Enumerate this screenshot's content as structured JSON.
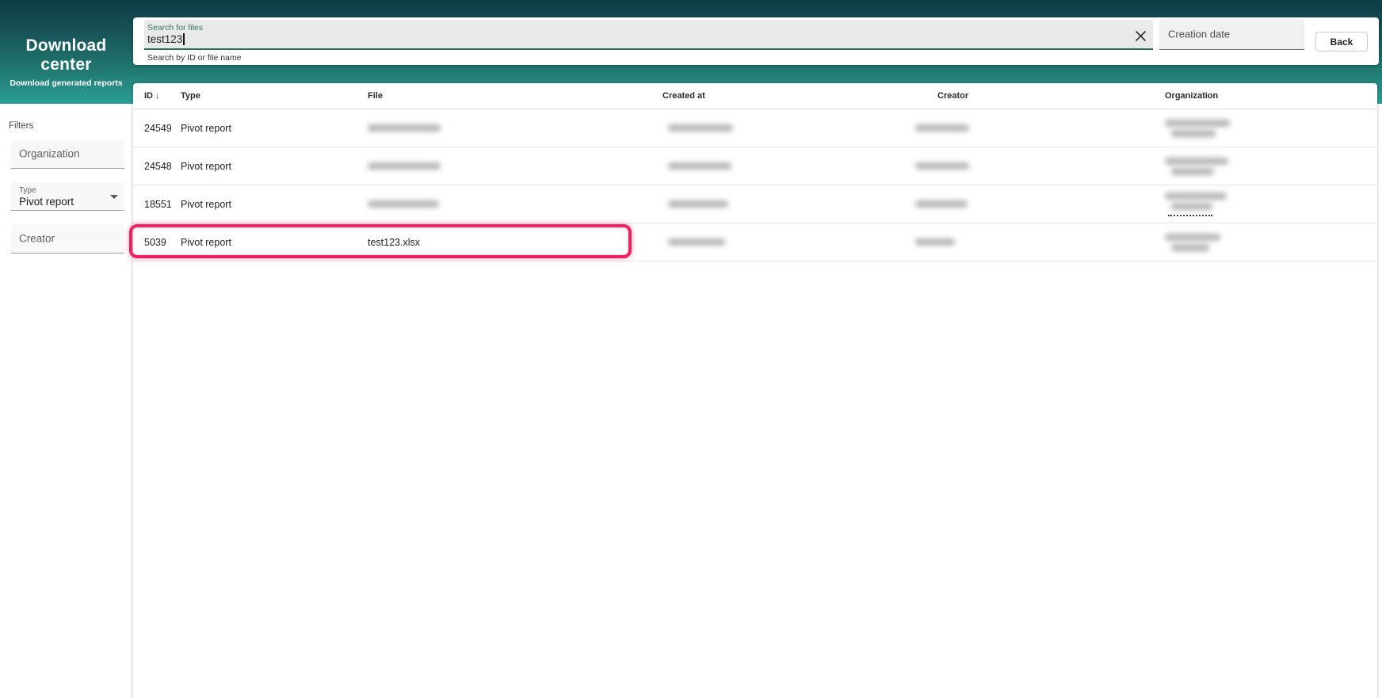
{
  "app": {
    "title": "Download center",
    "subtitle": "Download generated reports"
  },
  "search": {
    "label": "Search for files",
    "value": "test123",
    "helper": "Search by ID or file name",
    "clear_icon": "close-x"
  },
  "creation_date": {
    "placeholder": "Creation date"
  },
  "back_button": {
    "label": "Back"
  },
  "filters": {
    "heading": "Filters",
    "organization": {
      "placeholder": "Organization"
    },
    "type": {
      "label": "Type",
      "value": "Pivot report"
    },
    "creator": {
      "placeholder": "Creator"
    }
  },
  "table": {
    "columns": [
      "ID",
      "Type",
      "File",
      "Created at",
      "Creator",
      "Organization"
    ],
    "sort": {
      "column": "ID",
      "direction": "desc",
      "icon": "↓"
    },
    "rows": [
      {
        "id": "24549",
        "type": "Pivot report",
        "file": null,
        "created_at": null,
        "creator": null,
        "organization": null,
        "redacted": [
          "file",
          "created_at",
          "creator",
          "organization"
        ],
        "highlighted": false,
        "org_truncated": false
      },
      {
        "id": "24548",
        "type": "Pivot report",
        "file": null,
        "created_at": null,
        "creator": null,
        "organization": null,
        "redacted": [
          "file",
          "created_at",
          "creator",
          "organization"
        ],
        "highlighted": false,
        "org_truncated": false
      },
      {
        "id": "18551",
        "type": "Pivot report",
        "file": null,
        "created_at": null,
        "creator": null,
        "organization": null,
        "redacted": [
          "file",
          "created_at",
          "creator",
          "organization"
        ],
        "highlighted": false,
        "org_truncated": true
      },
      {
        "id": "5039",
        "type": "Pivot report",
        "file": "test123.xlsx",
        "created_at": null,
        "creator": null,
        "organization": null,
        "redacted": [
          "created_at",
          "creator",
          "organization"
        ],
        "highlighted": true,
        "org_truncated": false
      }
    ]
  },
  "colors": {
    "header_gradient_top": "#0e3d44",
    "header_gradient_bottom": "#2aa096",
    "search_underline": "#2a6f66",
    "search_label": "#33746c",
    "highlight_pink": "#f1205e",
    "input_fill": "#e9e9e9",
    "row_border": "#e7e7e7"
  }
}
